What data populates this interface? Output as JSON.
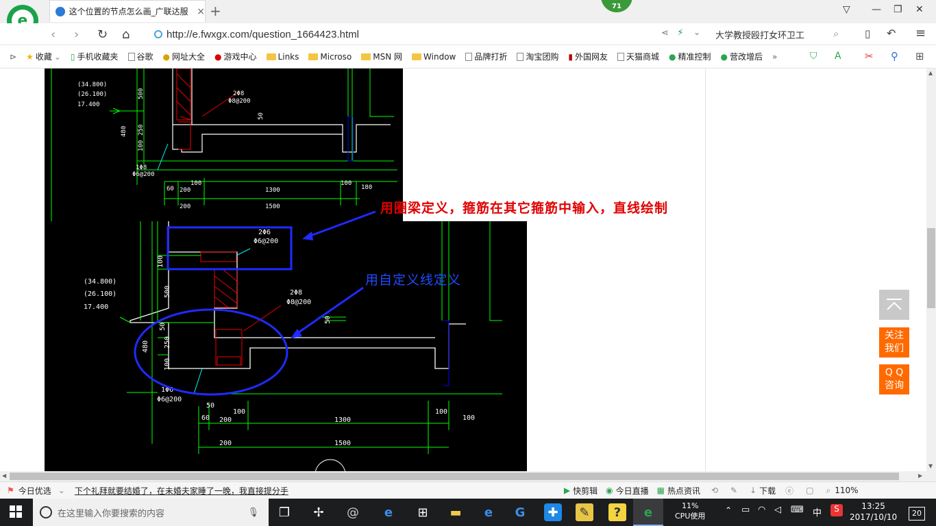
{
  "browser": {
    "tab_title": "这个位置的节点怎么画_广联达服",
    "tab_close": "×",
    "new_tab": "+",
    "notification_count": "71",
    "url": "http://e.fwxgx.com/question_1664423.html",
    "search_text": "大学教授殴打女环卫工"
  },
  "bookmarks": [
    {
      "label": "收藏",
      "icon": "star-icon"
    },
    {
      "label": "手机收藏夹",
      "icon": "phone-icon"
    },
    {
      "label": "谷歌",
      "icon": "page-icon"
    },
    {
      "label": "网址大全",
      "icon": "site-icon"
    },
    {
      "label": "游戏中心",
      "icon": "game-icon"
    },
    {
      "label": "Links",
      "icon": "folder-icon"
    },
    {
      "label": "Microso",
      "icon": "folder-icon"
    },
    {
      "label": "MSN 网",
      "icon": "folder-icon"
    },
    {
      "label": "Window",
      "icon": "folder-icon"
    },
    {
      "label": "品牌打折",
      "icon": "page-icon"
    },
    {
      "label": "淘宝团购",
      "icon": "page-icon"
    },
    {
      "label": "外国网友",
      "icon": "page-icon"
    },
    {
      "label": "天猫商城",
      "icon": "page-icon"
    },
    {
      "label": "精准控制",
      "icon": "wechat-icon"
    },
    {
      "label": "营改增后",
      "icon": "wechat-icon"
    },
    {
      "label": "»",
      "icon": "more-icon"
    }
  ],
  "annotations": {
    "red": "用圈梁定义，箍筋在其它箍筋中输入，直线绘制",
    "blue": "用自定义线定义"
  },
  "cad_top": {
    "elev1": "(34.800)",
    "elev2": "(26.100)",
    "elev3": "17.400",
    "dims": [
      "500",
      "250",
      "100",
      "480",
      "50",
      "60",
      "200",
      "100",
      "1300",
      "100",
      "180",
      "200",
      "1500"
    ],
    "rebar1": "2Φ8",
    "rebar1b": "Φ8@200",
    "rebar2": "1Φ8",
    "rebar2b": "Φ6@200"
  },
  "cad_bottom": {
    "elev1": "(34.800)",
    "elev2": "(26.100)",
    "elev3": "17.400",
    "top_rebar": "2Φ6",
    "top_stirrup": "Φ6@200",
    "mid_rebar": "2Φ8",
    "mid_stirrup": "Φ8@200",
    "bot_rebar": "1Φ6",
    "bot_stirrup": "Φ6@200",
    "dims": {
      "h100": "100",
      "h500": "500",
      "h50": "50",
      "h250": "250",
      "h480": "480",
      "h100b": "100",
      "w50": "50",
      "w60": "60",
      "w200": "200",
      "w100": "100",
      "w1300": "1300",
      "w100r": "100",
      "w100rr": "100",
      "w200b": "200",
      "w1500": "1500"
    }
  },
  "side_buttons": {
    "follow": "关注\n我们",
    "qq": "Q Q\n咨询"
  },
  "statusbar": {
    "today": "今日优选",
    "news": "下个礼拜就要结婚了，在未婚夫家睡了一晚，我直接提分手",
    "items": [
      "快剪辑",
      "今日直播",
      "热点资讯",
      "下载"
    ],
    "zoom": "110%"
  },
  "taskbar": {
    "search_placeholder": "在这里输入你要搜索的内容",
    "cpu_percent": "11%",
    "cpu_label": "CPU使用",
    "ime": "中",
    "time": "13:25",
    "date": "2017/10/10",
    "notif": "20"
  }
}
